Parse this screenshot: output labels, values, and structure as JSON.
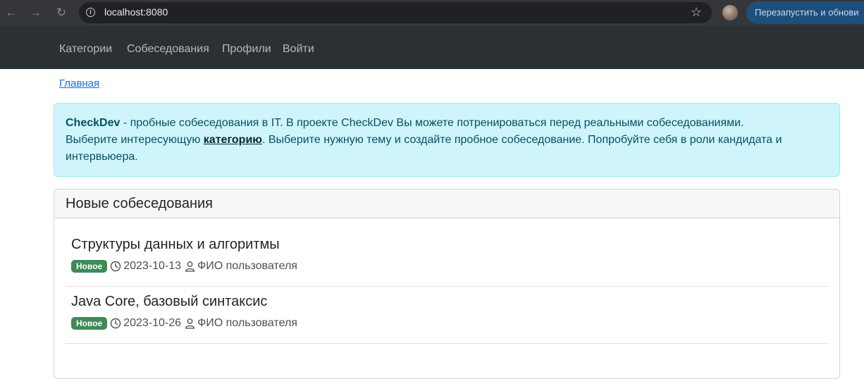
{
  "browser": {
    "url": "localhost:8080",
    "relaunch_label": "Перезапустить и обнови"
  },
  "navbar": {
    "items": [
      {
        "label": "Категории"
      },
      {
        "label": "Собеседования"
      },
      {
        "label": "Профили"
      },
      {
        "label": "Войти"
      }
    ]
  },
  "breadcrumb": {
    "home": "Главная"
  },
  "alert": {
    "brand": "CheckDev",
    "text_1": " - пробные собеседования в IT. В проекте CheckDev Вы можете потренироваться перед реальными собеседованиями.",
    "text_2": "Выберите интересующую ",
    "category_link": "категорию",
    "text_3": ". Выберите нужную тему и создайте пробное собеседование. Попробуйте себя в роли кандидата и интервьюера."
  },
  "interviews": {
    "header": "Новые собеседования",
    "items": [
      {
        "title": "Структуры данных и алгоритмы",
        "badge": "Новое",
        "date": "2023-10-13",
        "author": "ФИО пользователя"
      },
      {
        "title": "Java Core, базовый синтаксис",
        "badge": "Новое",
        "date": "2023-10-26",
        "author": "ФИО пользователя"
      }
    ]
  },
  "colors": {
    "navbar_bg": "#2b3035",
    "alert_bg": "#cff4fc",
    "badge_bg": "#3f8a56",
    "link": "#0d6efd"
  }
}
